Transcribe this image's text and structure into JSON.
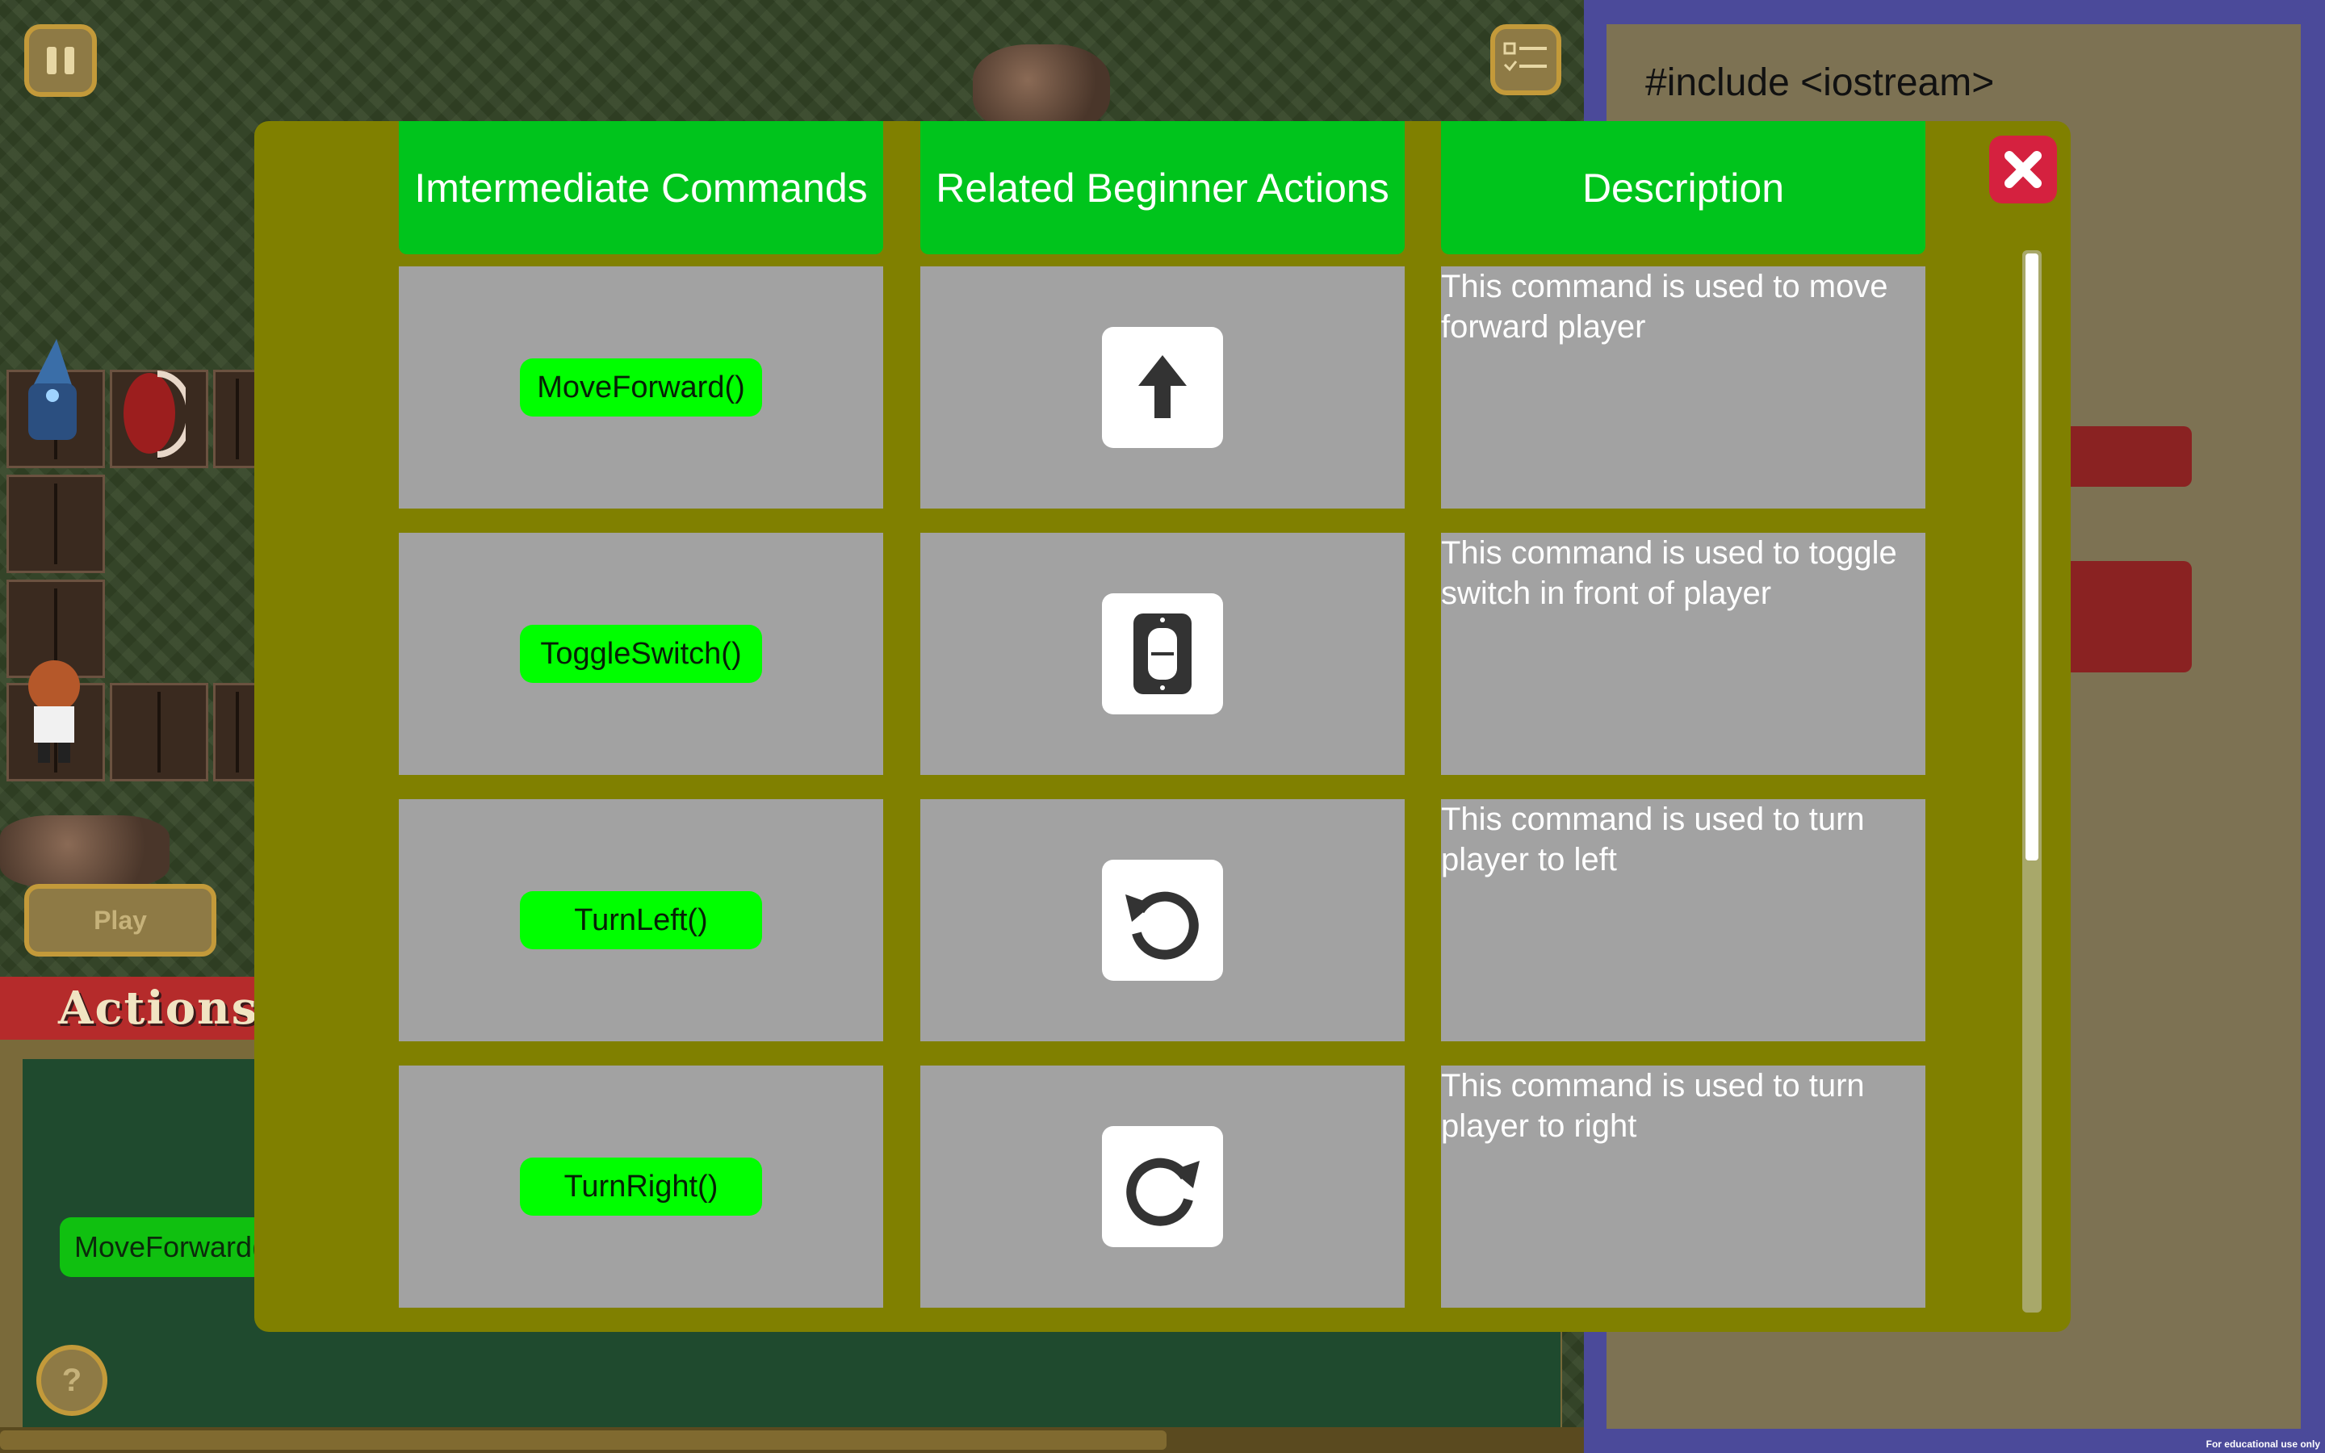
{
  "game": {
    "play_label": "Play",
    "actions_title": "Actions",
    "action_chip_label": "MoveForward()",
    "help_label": "?"
  },
  "code_panel": {
    "first_line": "#include <iostream>"
  },
  "modal": {
    "headers": [
      "Imtermediate Commands",
      "Related Beginner Actions",
      "Description"
    ],
    "rows": [
      {
        "command": "MoveForward()",
        "icon": "arrow-up-icon",
        "description": "This command is used to move forward player"
      },
      {
        "command": "ToggleSwitch()",
        "icon": "switch-icon",
        "description": "This command is used to toggle switch in front of player"
      },
      {
        "command": "TurnLeft()",
        "icon": "rotate-left-icon",
        "description": "This command is used to turn player to left"
      },
      {
        "command": "TurnRight()",
        "icon": "rotate-right-icon",
        "description": "This command is used to turn player to right"
      }
    ],
    "close_icon": "close-icon"
  },
  "footer_note": "For educational use only",
  "colors": {
    "modal_bg": "#808000",
    "header_green": "#00c41c",
    "chip_green": "#00ff00",
    "cell_gray": "#a2a2a2",
    "close_red": "#d5213f"
  }
}
